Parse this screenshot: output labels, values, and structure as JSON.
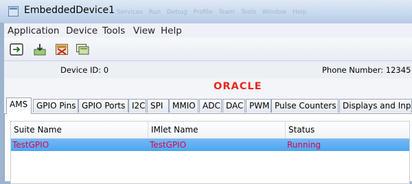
{
  "window": {
    "title": "EmbeddedDevice1",
    "background_menu_ghost": "Services Run Debug Profile Team Tools Window Help"
  },
  "menu": [
    "Application",
    "Device",
    "Tools",
    "View",
    "Help"
  ],
  "toolbar": {
    "buttons": [
      {
        "icon": "run-arrow-icon"
      },
      {
        "icon": "install-download-icon"
      },
      {
        "icon": "stop-app-icon"
      },
      {
        "icon": "screen-display-icon"
      }
    ]
  },
  "info": {
    "device_id": "Device ID: 0",
    "phone_number": "Phone Number: 12345"
  },
  "brand": {
    "logo_text": "ORACLE",
    "color": "#e8261f"
  },
  "tabs": [
    "AMS",
    "GPIO Pins",
    "GPIO Ports",
    "I2C",
    "SPI",
    "MMIO",
    "ADC",
    "DAC",
    "PWM",
    "Pulse Counters",
    "Displays and Inpu"
  ],
  "active_tab": "AMS",
  "table": {
    "columns": [
      "Suite Name",
      "IMlet Name",
      "Status"
    ],
    "rows": [
      {
        "suite": "TestGPIO",
        "imlet": "TestGPIO",
        "status": "Running"
      }
    ]
  },
  "colors": {
    "selection": "#4ea7ef",
    "row_text": "#e0004c"
  }
}
